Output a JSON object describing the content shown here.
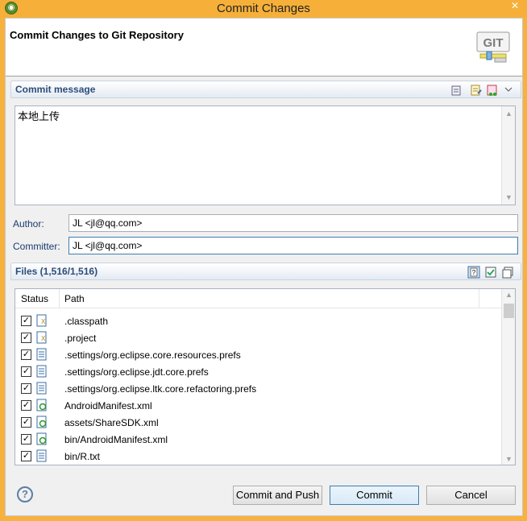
{
  "window": {
    "title": "Commit Changes",
    "close_glyph": "✕"
  },
  "header": {
    "title": "Commit Changes to Git Repository",
    "logo_text": "GIT"
  },
  "commit_message": {
    "section_label": "Commit message",
    "text": "本地上传",
    "toolbar_icons": [
      "spell-check-icon",
      "previous-messages-icon",
      "add-signed-off-icon",
      "section-menu-chevron-icon"
    ]
  },
  "author": {
    "label": "Author:",
    "value": "JL <jl@qq.com>"
  },
  "committer": {
    "label": "Committer:",
    "value": "JL <jl@qq.com>"
  },
  "files": {
    "section_label": "Files (1,516/1,516)",
    "columns": [
      "Status",
      "Path"
    ],
    "rows": [
      {
        "path": ".classpath",
        "icon": "xml-file-icon",
        "checked": true
      },
      {
        "path": ".project",
        "icon": "xml-file-icon",
        "checked": true
      },
      {
        "path": ".settings/org.eclipse.core.resources.prefs",
        "icon": "text-file-icon",
        "checked": true
      },
      {
        "path": ".settings/org.eclipse.jdt.core.prefs",
        "icon": "text-file-icon",
        "checked": true
      },
      {
        "path": ".settings/org.eclipse.ltk.core.refactoring.prefs",
        "icon": "text-file-icon",
        "checked": true
      },
      {
        "path": "AndroidManifest.xml",
        "icon": "android-xml-file-icon",
        "checked": true
      },
      {
        "path": "assets/ShareSDK.xml",
        "icon": "android-xml-file-icon",
        "checked": true
      },
      {
        "path": "bin/AndroidManifest.xml",
        "icon": "android-xml-file-icon",
        "checked": true
      },
      {
        "path": "bin/R.txt",
        "icon": "text-file-icon",
        "checked": true
      }
    ]
  },
  "buttons": {
    "help": "?",
    "commit_and_push": "Commit and Push",
    "commit": "Commit",
    "cancel": "Cancel"
  },
  "colors": {
    "title_bar": "#f6b03a",
    "section_label": "#2b4d7a",
    "field_label": "#1a3b6e"
  }
}
